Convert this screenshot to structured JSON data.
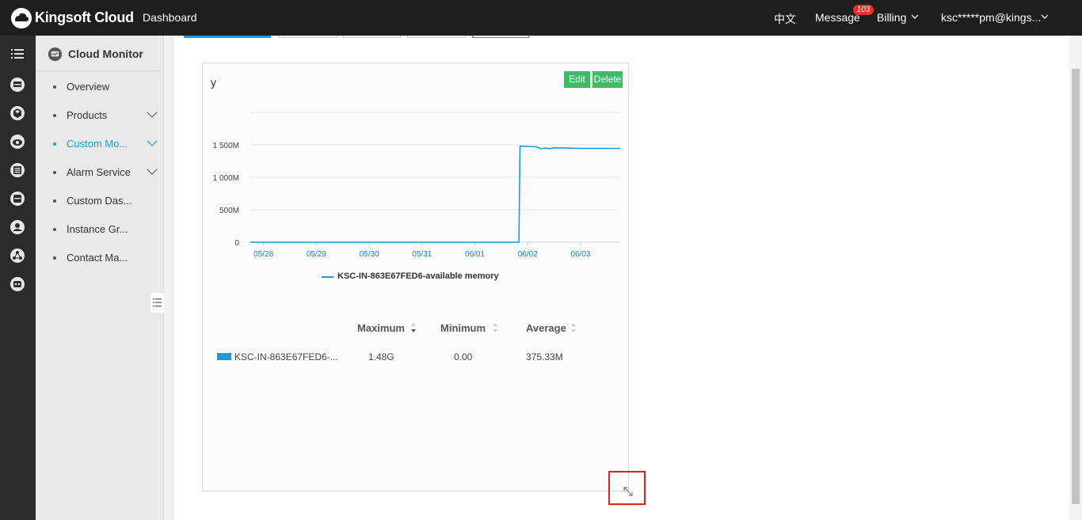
{
  "header": {
    "brand": "Kingsoft Cloud",
    "dashboard": "Dashboard",
    "language": "中文",
    "message": "Message",
    "message_count": "103",
    "billing": "Billing",
    "account": "ksc*****pm@kings..."
  },
  "sidebar": {
    "title": "Cloud Monitor",
    "items": [
      {
        "label": "Overview",
        "has_children": false,
        "active": false
      },
      {
        "label": "Products",
        "has_children": true,
        "active": false
      },
      {
        "label": "Custom Mo...",
        "has_children": true,
        "active": true
      },
      {
        "label": "Alarm Service",
        "has_children": true,
        "active": false
      },
      {
        "label": "Custom Das...",
        "has_children": false,
        "active": false
      },
      {
        "label": "Instance Gr...",
        "has_children": false,
        "active": false
      },
      {
        "label": "Contact Ma...",
        "has_children": false,
        "active": false
      }
    ]
  },
  "rail_icons": [
    "chart-board-icon",
    "cube-icon",
    "cloud-eye-icon",
    "list-icon",
    "database-icon",
    "user-shield-icon",
    "network-icon",
    "robot-icon"
  ],
  "card": {
    "title": "y",
    "edit_label": "Edit",
    "delete_label": "Delete",
    "legend_label": "KSC-IN-863E67FED6-available memory",
    "table": {
      "headers": [
        "Maximum",
        "Minimum",
        "Average"
      ],
      "row": {
        "name": "KSC-IN-863E67FED6-...",
        "maximum": "1.48G",
        "minimum": "0.00",
        "average": "375.33M"
      }
    }
  },
  "colors": {
    "accent": "#1e9bd7",
    "button_green": "#3fba6a",
    "highlight_red": "#e02020",
    "topbar": "#1e1e1e"
  },
  "chart_data": {
    "type": "line",
    "title": "y",
    "x_ticks": [
      "05/28",
      "05/29",
      "05/30",
      "05/31",
      "06/01",
      "06/02",
      "06/03"
    ],
    "y_ticks": [
      "0",
      "500M",
      "1 000M",
      "1 500M"
    ],
    "ylim": [
      0,
      2000
    ],
    "y_unit": "M",
    "xlim": [
      "05/27 18:00",
      "06/03 18:00"
    ],
    "grid": true,
    "legend_position": "bottom",
    "series": [
      {
        "name": "KSC-IN-863E67FED6-available memory",
        "color": "#1e9bd7",
        "points": [
          {
            "x": "05/27 18:00",
            "y": 0
          },
          {
            "x": "06/01 20:00",
            "y": 0
          },
          {
            "x": "06/01 20:30",
            "y": 1480
          },
          {
            "x": "06/02 04:00",
            "y": 1470
          },
          {
            "x": "06/02 06:00",
            "y": 1440
          },
          {
            "x": "06/02 08:00",
            "y": 1450
          },
          {
            "x": "06/02 10:00",
            "y": 1440
          },
          {
            "x": "06/02 12:00",
            "y": 1455
          },
          {
            "x": "06/02 18:00",
            "y": 1450
          },
          {
            "x": "06/03 00:00",
            "y": 1445
          },
          {
            "x": "06/03 18:00",
            "y": 1445
          }
        ]
      }
    ]
  }
}
